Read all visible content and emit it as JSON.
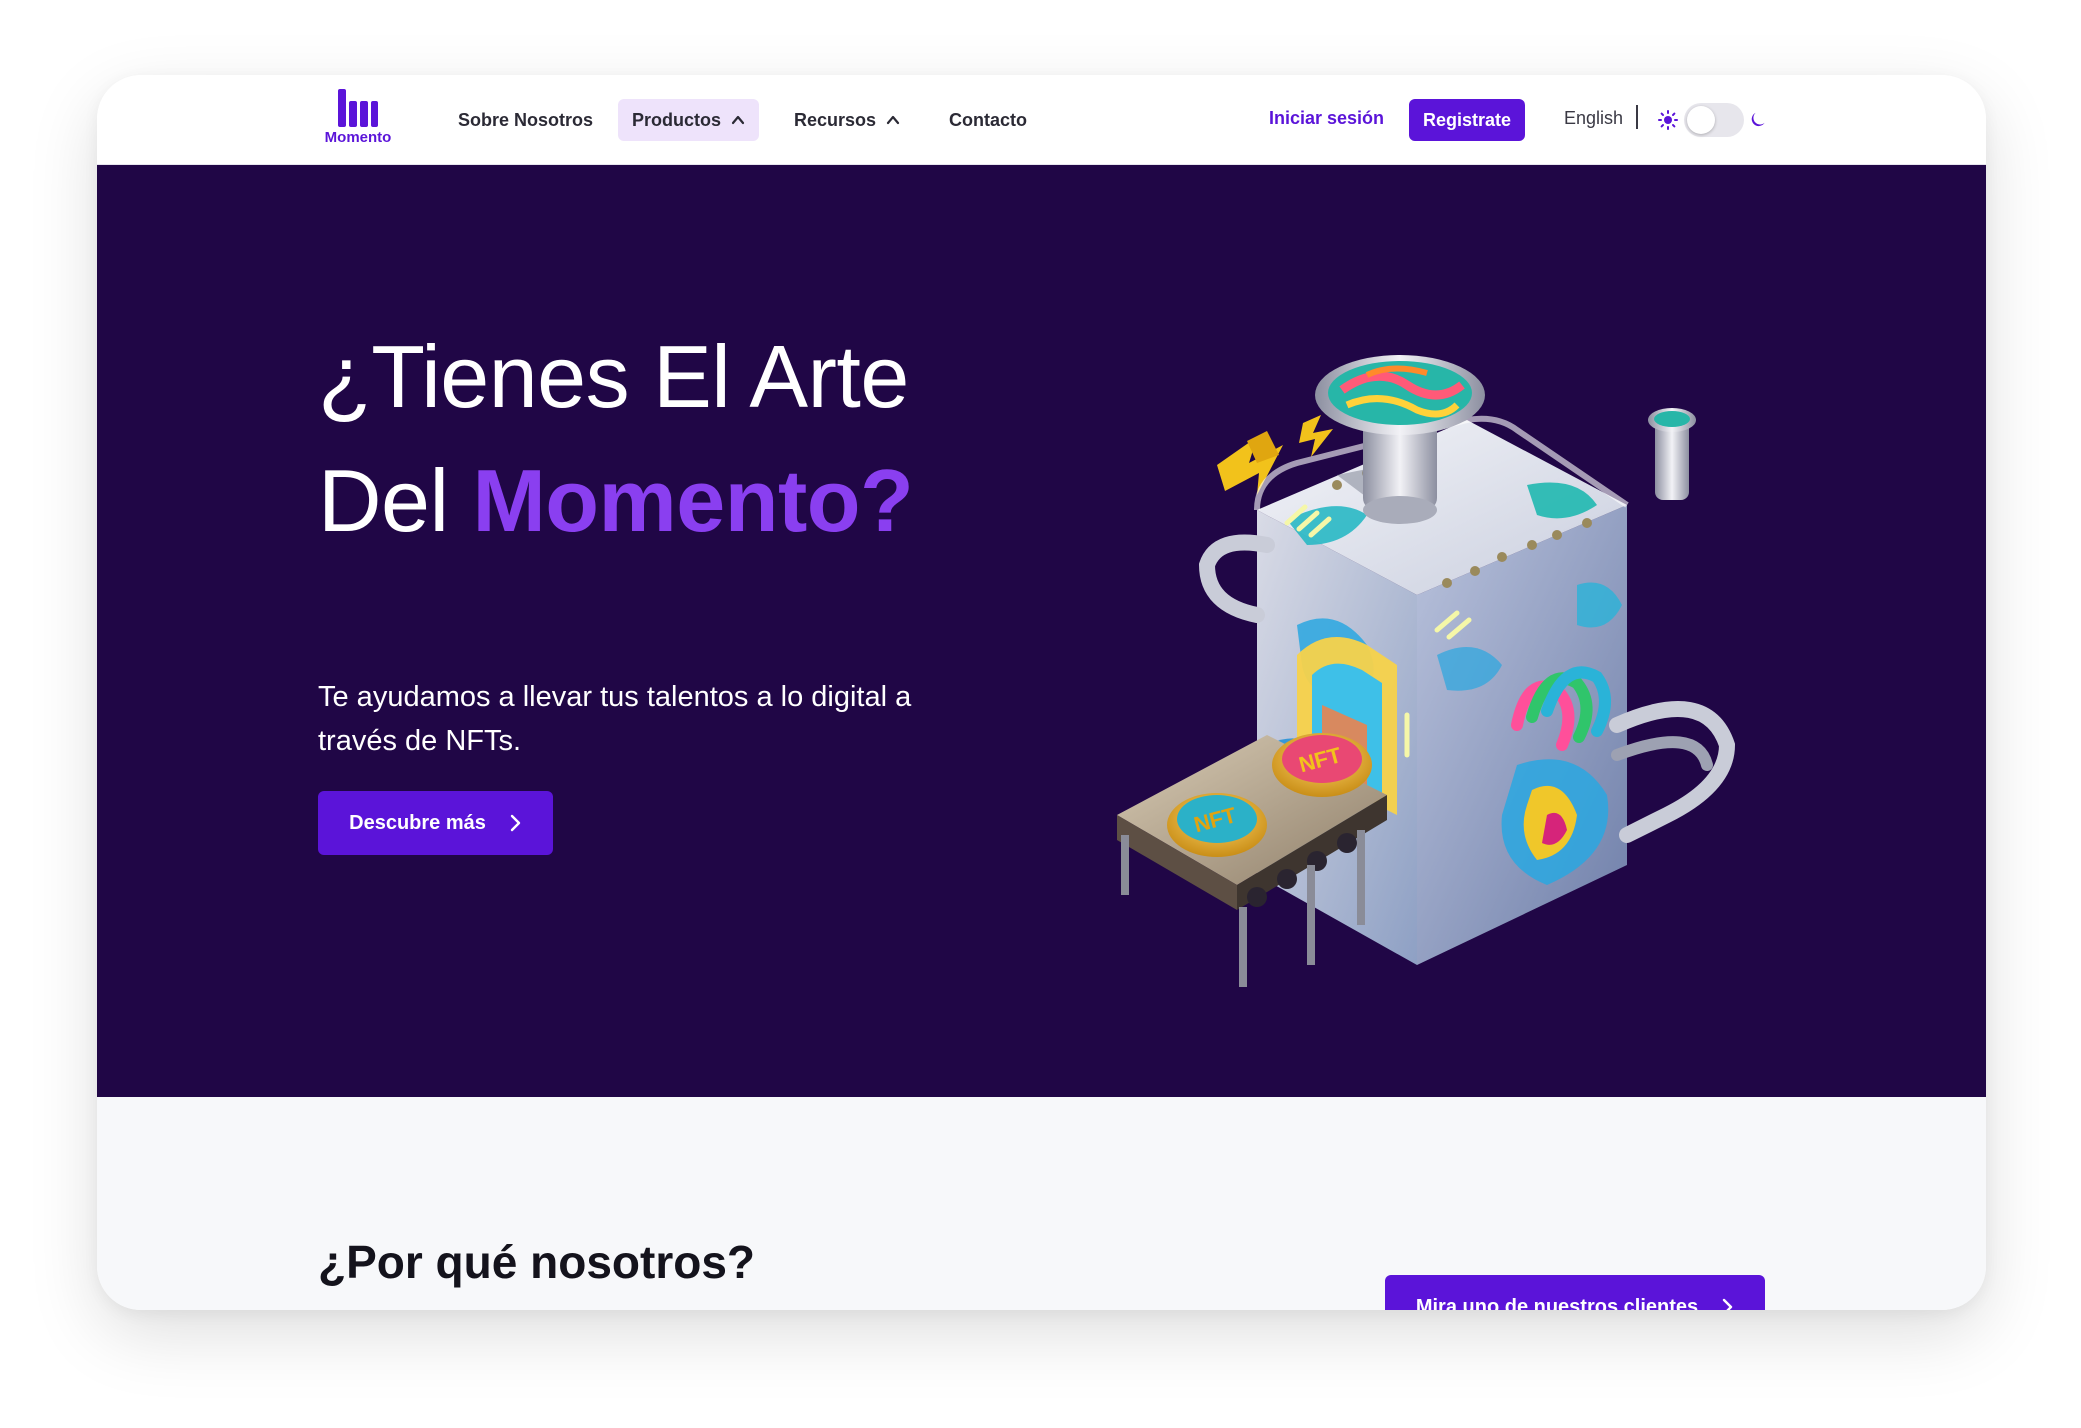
{
  "brand": {
    "name": "Momento",
    "color": "#5b14d9",
    "accent": "#8a3ff0"
  },
  "nav": {
    "links": [
      {
        "label": "Sobre Nosotros",
        "icon": null
      },
      {
        "label": "Productos",
        "icon": "chevron-up-icon",
        "active": true
      },
      {
        "label": "Recursos",
        "icon": "chevron-up-icon"
      },
      {
        "label": "Contacto",
        "icon": null
      }
    ],
    "login_label": "Iniciar sesión",
    "signup_label": "Registrate",
    "language_label": "English",
    "theme_toggle": {
      "light_icon": "sun-icon",
      "dark_icon": "moon-icon",
      "state": "light"
    }
  },
  "hero": {
    "title_line1": "¿Tienes El Arte",
    "title_line2_prefix": "Del ",
    "title_line2_accent": "Momento?",
    "subtitle": "Te ayudamos a llevar tus talentos a lo digital a través de NFTs.",
    "cta_label": "Descubre más",
    "cta_icon": "chevron-right-icon",
    "background": "#200646",
    "illustration": "nft-machine-illustration"
  },
  "why_section": {
    "title": "¿Por qué nosotros?",
    "client_button_label": "Mira uno de nuestros clientes",
    "client_button_icon": "chevron-right-icon"
  }
}
